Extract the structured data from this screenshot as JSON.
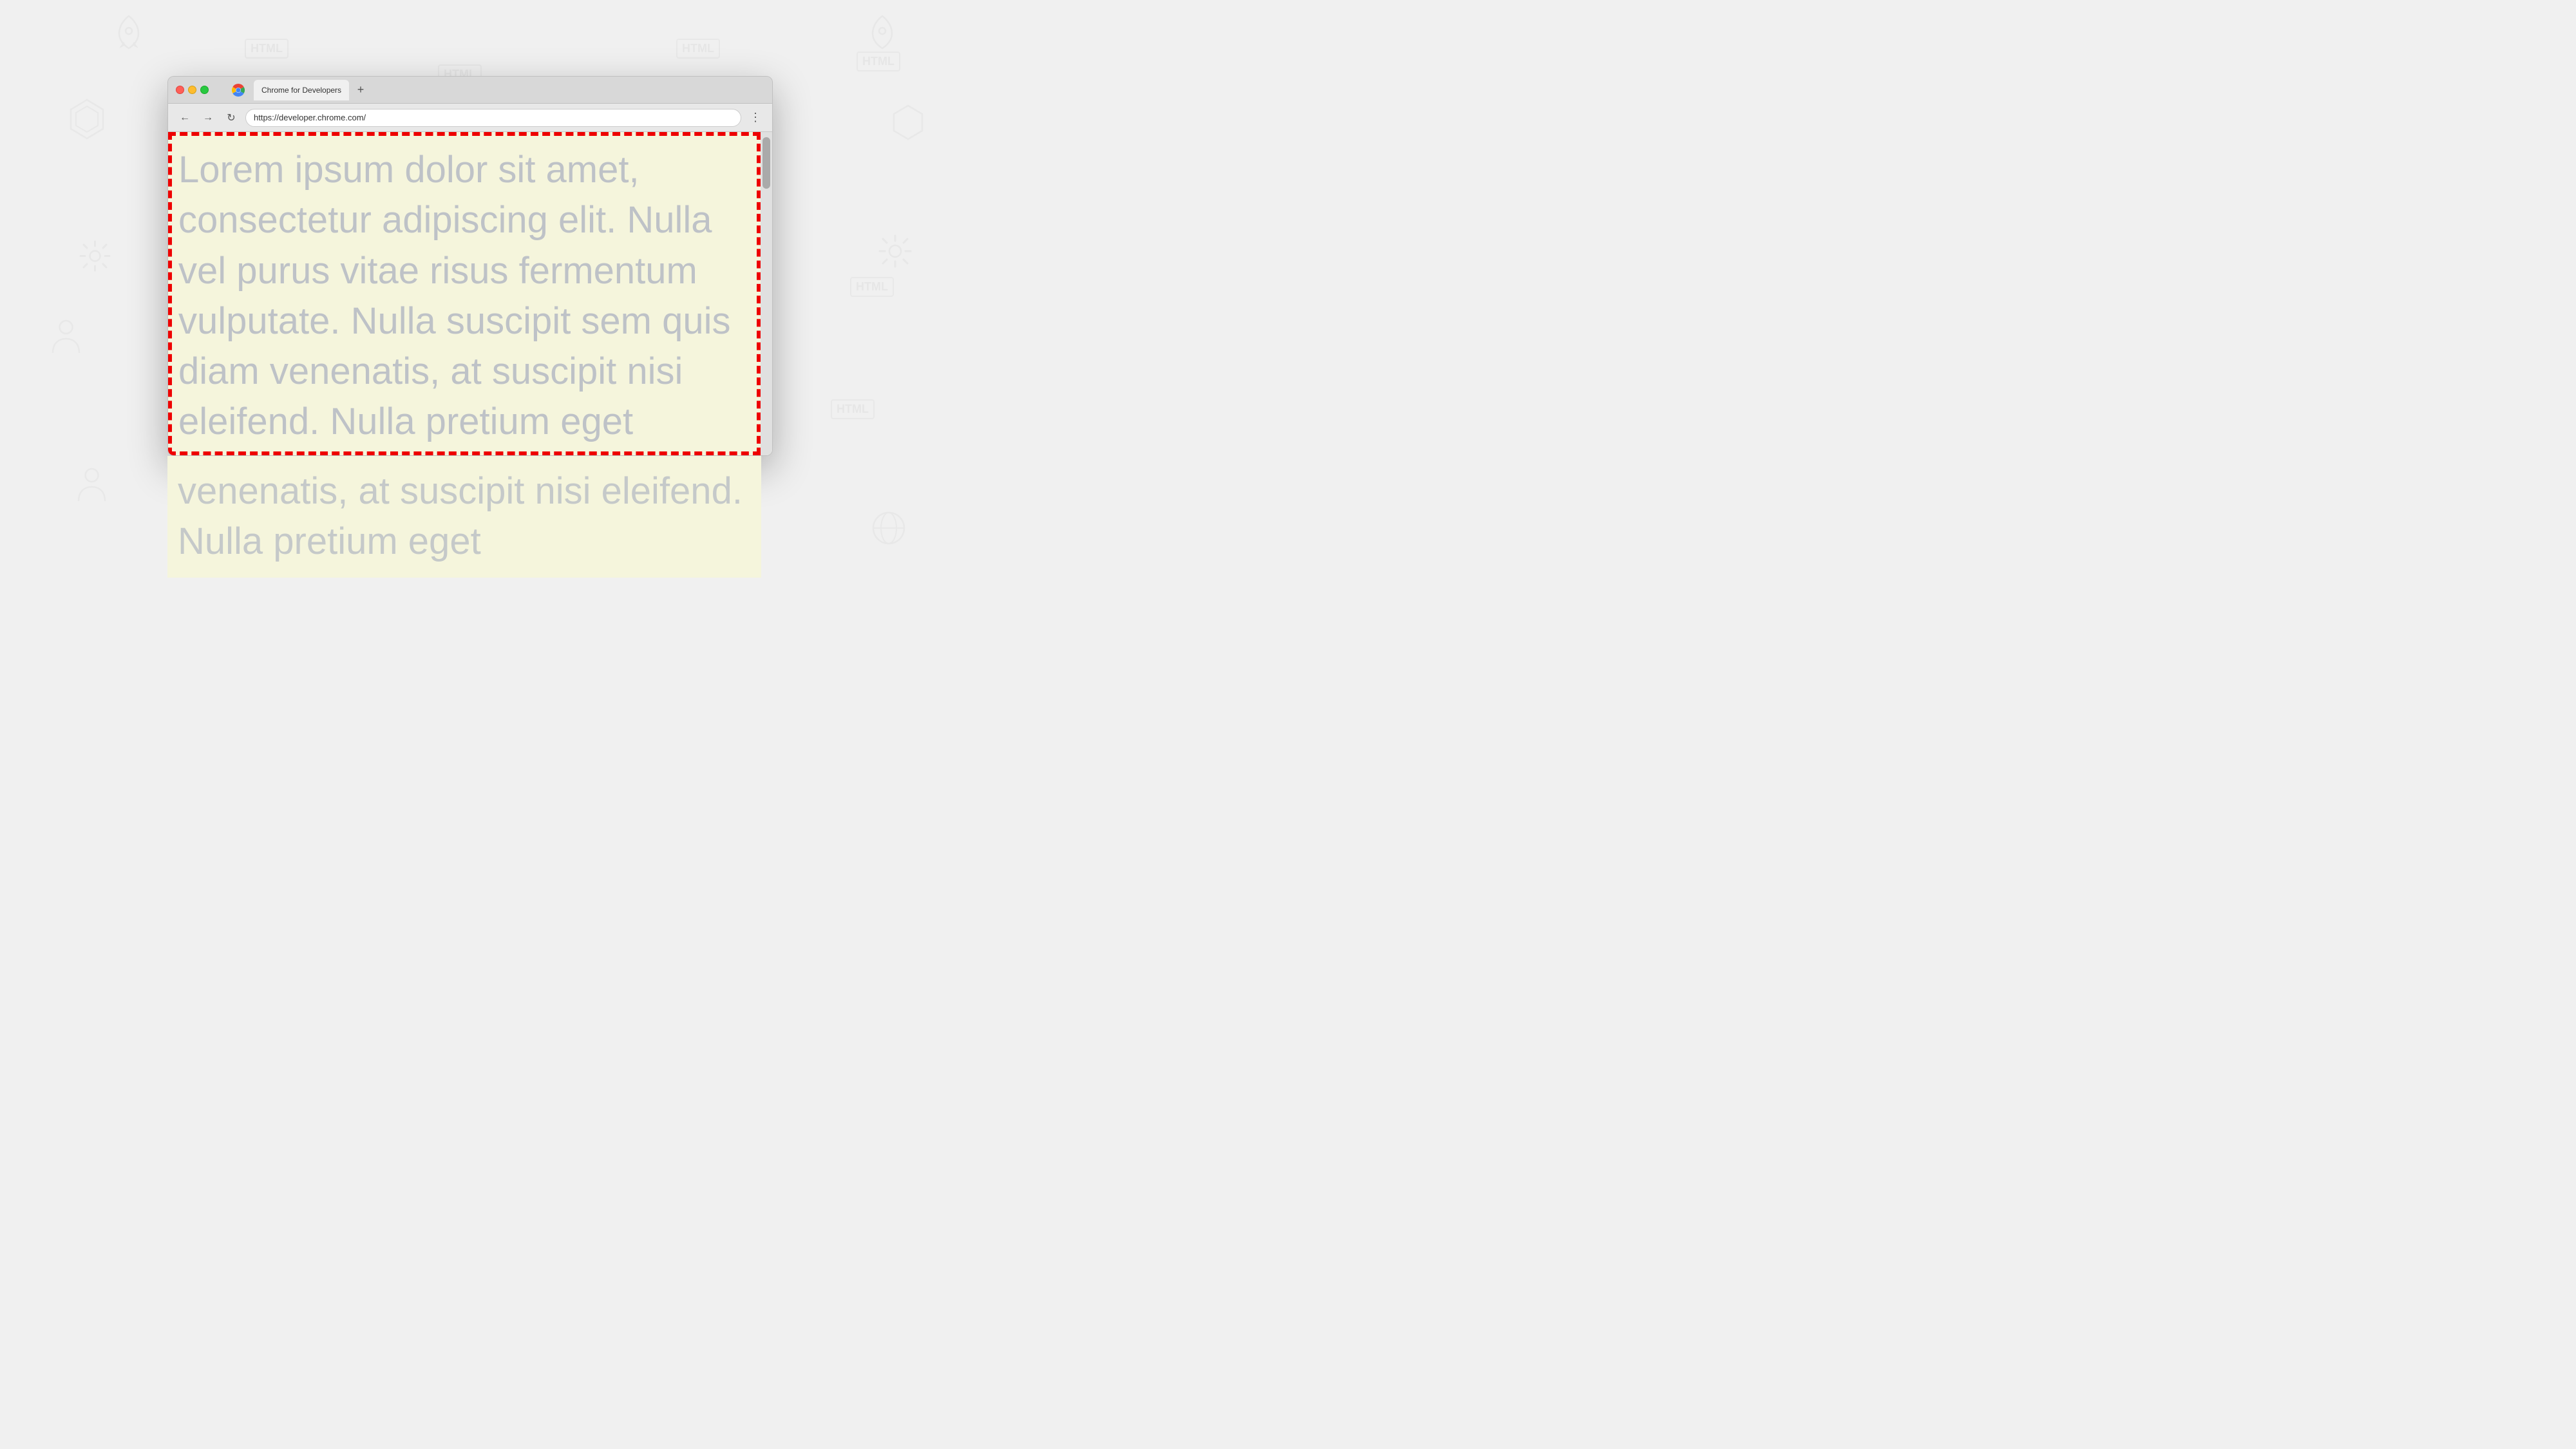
{
  "background": {
    "color": "#f0f0f0"
  },
  "browser": {
    "tab_title": "Chrome for Developers",
    "tab_plus_label": "+",
    "address_url": "https://developer.chrome.com/",
    "nav_back_icon": "←",
    "nav_forward_icon": "→",
    "nav_reload_icon": "↻",
    "menu_icon": "⋮",
    "traffic_lights": {
      "red": "#ff5f57",
      "yellow": "#febc2e",
      "green": "#28c840"
    }
  },
  "content": {
    "background_color": "#f5f5dc",
    "lorem_text": "Lorem ipsum dolor sit amet, consectetur adipiscing elit. Nulla vel purus vitae risus fermentum vulputate. Nulla suscipit sem quis diam venenatis, at suscipit nisi eleifend. Nulla pretium eget",
    "text_color": "rgba(180, 185, 195, 0.85)",
    "border_color": "#ee0000",
    "border_style": "dashed"
  }
}
